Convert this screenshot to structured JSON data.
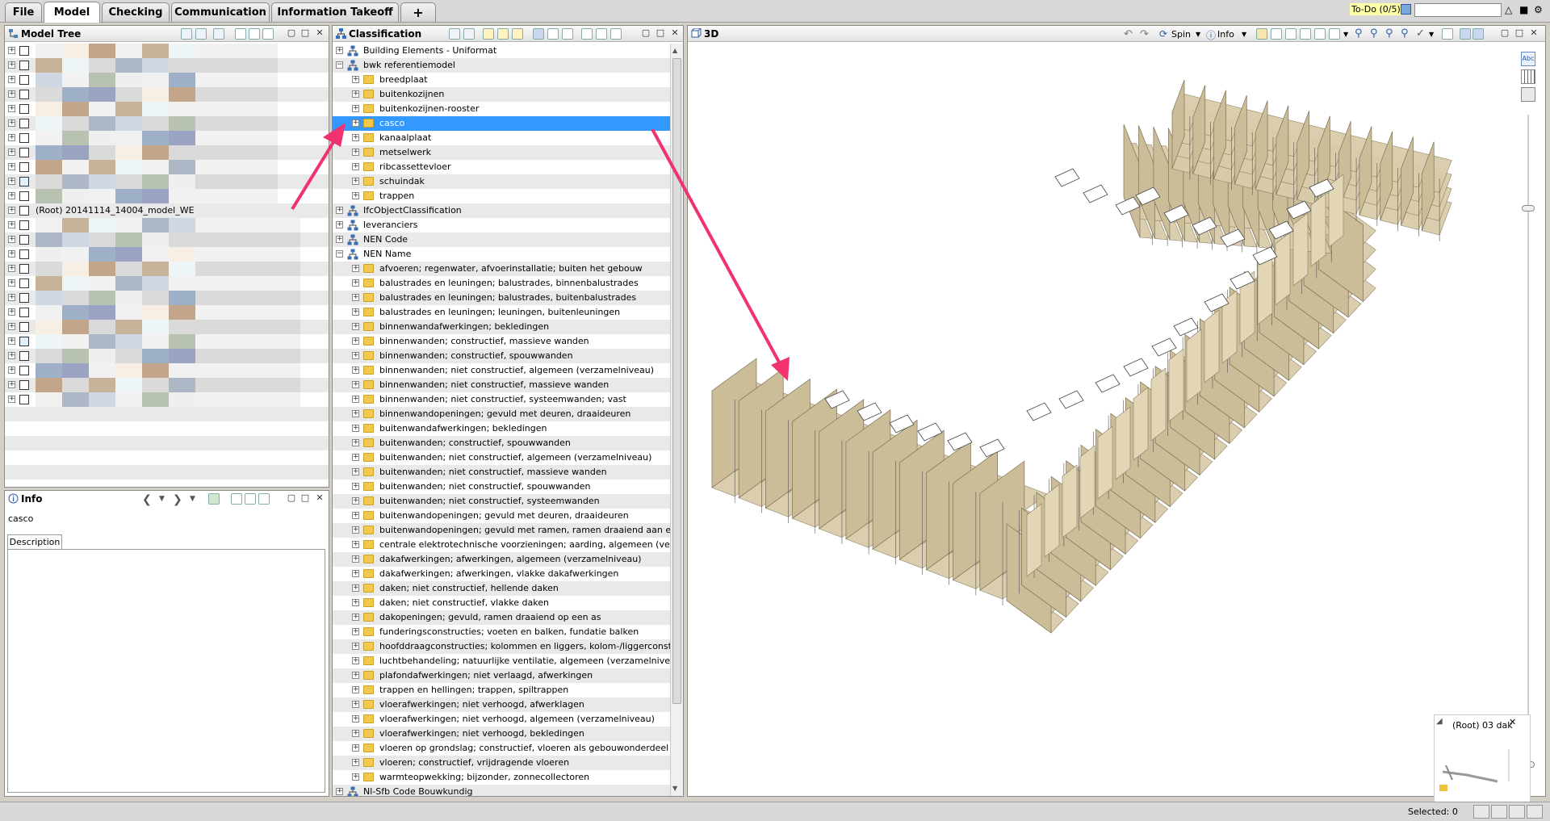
{
  "top_tabs": [
    {
      "label": "File"
    },
    {
      "label": "Model"
    },
    {
      "label": "Checking"
    },
    {
      "label": "Communication"
    },
    {
      "label": "Information Takeoff"
    },
    {
      "label": "+"
    }
  ],
  "todo_label": "To-Do (0/5)",
  "model_tree": {
    "title": "Model Tree",
    "root_label": "(Root) 20141114_14004_model_WE"
  },
  "info": {
    "title": "Info",
    "selected_name": "casco",
    "tab_label": "Description"
  },
  "classification": {
    "title": "Classification",
    "items": [
      {
        "label": "Building Elements - Uniformat",
        "level": 0,
        "expanded": false
      },
      {
        "label": "bwk referentiemodel",
        "level": 0,
        "expanded": true
      },
      {
        "label": "breedplaat",
        "level": 1
      },
      {
        "label": "buitenkozijnen",
        "level": 1
      },
      {
        "label": "buitenkozijnen-rooster",
        "level": 1
      },
      {
        "label": "casco",
        "level": 1,
        "selected": true
      },
      {
        "label": "kanaalplaat",
        "level": 1
      },
      {
        "label": "metselwerk",
        "level": 1
      },
      {
        "label": "ribcassettevloer",
        "level": 1
      },
      {
        "label": "schuindak",
        "level": 1
      },
      {
        "label": "trappen",
        "level": 1
      },
      {
        "label": "IfcObjectClassification",
        "level": 0,
        "expanded": false
      },
      {
        "label": "leveranciers",
        "level": 0,
        "expanded": false
      },
      {
        "label": "NEN Code",
        "level": 0,
        "expanded": false
      },
      {
        "label": "NEN Name",
        "level": 0,
        "expanded": true
      },
      {
        "label": "afvoeren; regenwater, afvoerinstallatie; buiten het gebouw",
        "level": 1
      },
      {
        "label": "balustrades en leuningen; balustrades, binnenbalustrades",
        "level": 1
      },
      {
        "label": "balustrades en leuningen; balustrades, buitenbalustrades",
        "level": 1
      },
      {
        "label": "balustrades en leuningen; leuningen, buitenleuningen",
        "level": 1
      },
      {
        "label": "binnenwandafwerkingen; bekledingen",
        "level": 1
      },
      {
        "label": "binnenwanden; constructief, massieve wanden",
        "level": 1
      },
      {
        "label": "binnenwanden; constructief, spouwwanden",
        "level": 1
      },
      {
        "label": "binnenwanden; niet constructief, algemeen (verzamelniveau)",
        "level": 1
      },
      {
        "label": "binnenwanden; niet constructief, massieve wanden",
        "level": 1
      },
      {
        "label": "binnenwanden; niet constructief, systeemwanden; vast",
        "level": 1
      },
      {
        "label": "binnenwandopeningen; gevuld met deuren, draaideuren",
        "level": 1
      },
      {
        "label": "buitenwandafwerkingen; bekledingen",
        "level": 1
      },
      {
        "label": "buitenwanden; constructief, spouwwanden",
        "level": 1
      },
      {
        "label": "buitenwanden; niet constructief, algemeen (verzamelniveau)",
        "level": 1
      },
      {
        "label": "buitenwanden; niet constructief, massieve wanden",
        "level": 1
      },
      {
        "label": "buitenwanden; niet constructief, spouwwanden",
        "level": 1
      },
      {
        "label": "buitenwanden; niet constructief, systeemwanden",
        "level": 1
      },
      {
        "label": "buitenwandopeningen; gevuld met deuren, draaideuren",
        "level": 1
      },
      {
        "label": "buitenwandopeningen; gevuld met ramen, ramen draaiend aan een kan",
        "level": 1
      },
      {
        "label": "centrale elektrotechnische voorzieningen; aarding, algemeen (verzame",
        "level": 1
      },
      {
        "label": "dakafwerkingen; afwerkingen, algemeen (verzamelniveau)",
        "level": 1
      },
      {
        "label": "dakafwerkingen; afwerkingen, vlakke dakafwerkingen",
        "level": 1
      },
      {
        "label": "daken; niet constructief, hellende daken",
        "level": 1
      },
      {
        "label": "daken; niet constructief, vlakke daken",
        "level": 1
      },
      {
        "label": "dakopeningen; gevuld, ramen draaiend op een as",
        "level": 1
      },
      {
        "label": "funderingsconstructies; voeten en balken, fundatie balken",
        "level": 1
      },
      {
        "label": "hoofddraagconstructies; kolommen en liggers, kolom-/liggerconstructies",
        "level": 1
      },
      {
        "label": "luchtbehandeling; natuurlijke ventilatie, algemeen (verzamelniveau)",
        "level": 1
      },
      {
        "label": "plafondafwerkingen; niet verlaagd, afwerkingen",
        "level": 1
      },
      {
        "label": "trappen en hellingen; trappen, spiltrappen",
        "level": 1
      },
      {
        "label": "vloerafwerkingen; niet verhoogd, afwerklagen",
        "level": 1
      },
      {
        "label": "vloerafwerkingen; niet verhoogd, algemeen (verzamelniveau)",
        "level": 1
      },
      {
        "label": "vloerafwerkingen; niet verhoogd, bekledingen",
        "level": 1
      },
      {
        "label": "vloeren op grondslag; constructief, vloeren als gebouwonderdeel",
        "level": 1
      },
      {
        "label": "vloeren; constructief, vrijdragende vloeren",
        "level": 1
      },
      {
        "label": "warmteopwekking; bijzonder, zonnecollectoren",
        "level": 1
      },
      {
        "label": "Nl-Sfb Code Bouwkundig",
        "level": 0,
        "expanded": false
      }
    ]
  },
  "view3d": {
    "title": "3D",
    "spin_label": "Spin",
    "info_label": "Info",
    "minimap_label": "(Root) 03 dak"
  },
  "status": {
    "selected_text": "Selected: 0"
  },
  "colors": {
    "selection": "#3399ff",
    "arrow": "#f0336e",
    "building": "#d9ccaa"
  }
}
